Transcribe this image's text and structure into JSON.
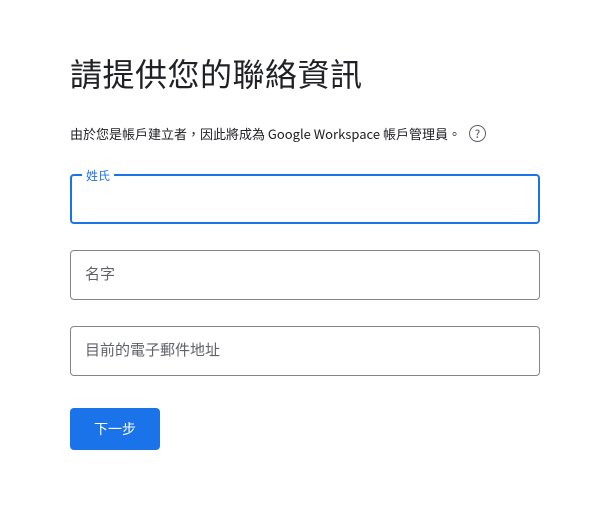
{
  "heading": "請提供您的聯絡資訊",
  "subtext": "由於您是帳戶建立者，因此將成為 Google Workspace 帳戶管理員。",
  "help_glyph": "?",
  "fields": {
    "last_name": {
      "label": "姓氏",
      "value": ""
    },
    "first_name": {
      "placeholder": "名字",
      "value": ""
    },
    "email": {
      "placeholder": "目前的電子郵件地址",
      "value": ""
    }
  },
  "next_button": "下一步"
}
